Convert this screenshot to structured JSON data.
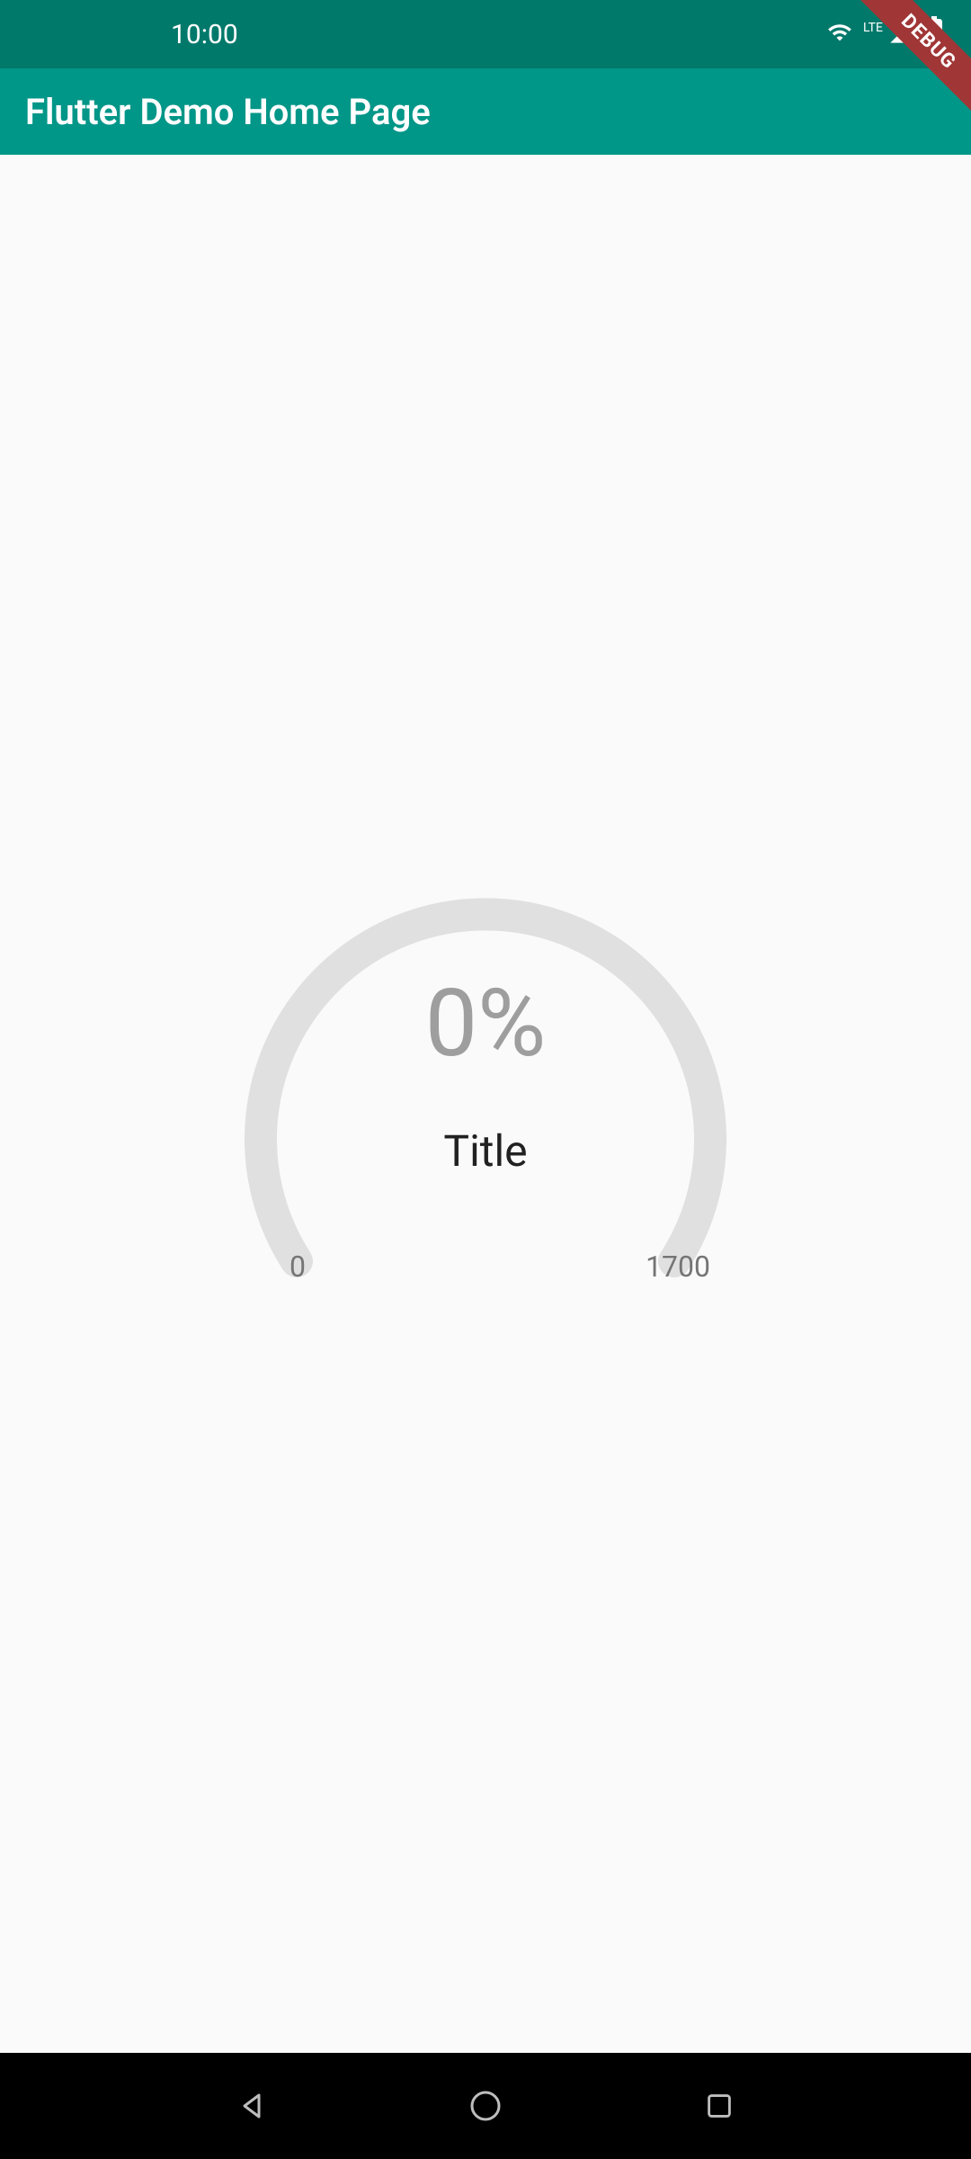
{
  "status_bar": {
    "time": "10:00",
    "lte_label": "LTE"
  },
  "debug_banner": "DEBUG",
  "app_bar": {
    "title": "Flutter Demo Home Page"
  },
  "gauge": {
    "percent_text": "0%",
    "title": "Title",
    "min_label": "0",
    "max_label": "1700"
  },
  "chart_data": {
    "type": "gauge",
    "value": 0,
    "min": 0,
    "max": 1700,
    "percent": 0,
    "title": "Title"
  },
  "colors": {
    "primary": "#009688",
    "primary_dark": "#00796b",
    "gauge_track": "#e0e0e0",
    "text_secondary": "#9e9e9e"
  }
}
